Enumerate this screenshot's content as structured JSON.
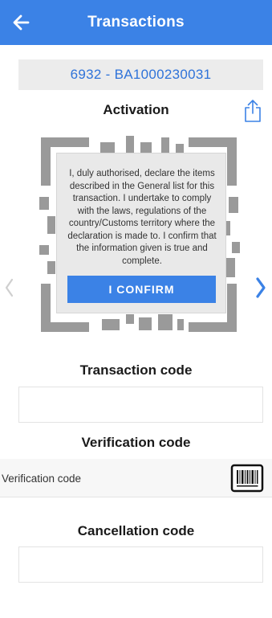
{
  "header": {
    "title": "Transactions",
    "back_icon": "arrow-left-icon"
  },
  "transaction_id": "6932 - BA1000230031",
  "activation": {
    "title": "Activation",
    "share_icon": "share-icon"
  },
  "confirmation": {
    "text": "I, duly authorised, declare the items described in the General list for this transaction. I undertake to comply with the laws, regulations of the country/Customs territory where the declaration is made to. I confirm that the information given is true and complete.",
    "button_label": "I CONFIRM"
  },
  "carousel": {
    "prev_icon": "chevron-left-icon",
    "next_icon": "chevron-right-icon"
  },
  "transaction_code": {
    "title": "Transaction code",
    "value": ""
  },
  "verification_code": {
    "title": "Verification code",
    "placeholder": "Verification code",
    "value": "",
    "scan_icon": "barcode-icon"
  },
  "cancellation_code": {
    "title": "Cancellation code",
    "value": ""
  },
  "colors": {
    "primary": "#3b82e6",
    "id_text": "#2f73d9",
    "qr": "#9a9a9a"
  }
}
